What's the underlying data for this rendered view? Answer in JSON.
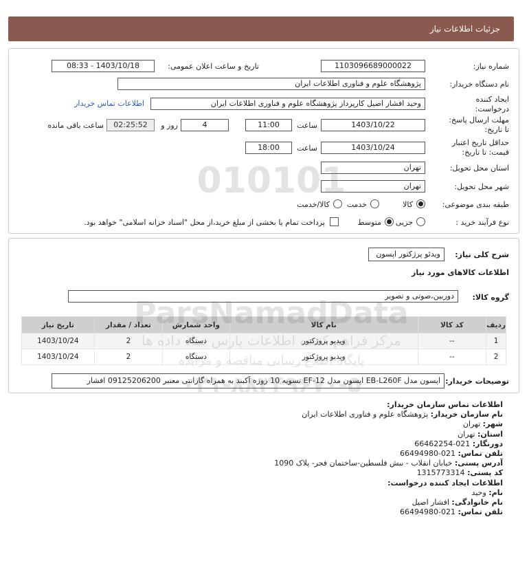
{
  "header": {
    "title": "جزئیات اطلاعات نیاز"
  },
  "form": {
    "need_number_label": "شماره نیاز:",
    "need_number": "1103096689000022",
    "announce_label": "تاریخ و ساعت اعلان عمومی:",
    "announce_value": "1403/10/18 - 08:33",
    "buyer_org_label": "نام دستگاه خریدار:",
    "buyer_org": "پژوهشگاه علوم و فناوری اطلاعات ایران",
    "creator_label_1": "ایجاد کننده",
    "creator_label_2": "درخواست:",
    "creator_value": "وحید افشار اصیل کارپرداز  پژوهشگاه علوم و فناوری اطلاعات ایران",
    "buyer_contact_link": "اطلاعات تماس خریدار",
    "reply_deadline_label_1": "مهلت ارسال پاسخ:",
    "reply_deadline_label_2": "تا تاریخ:",
    "reply_date": "1403/10/22",
    "time_label": "ساعت",
    "reply_time": "11:00",
    "days_value": "4",
    "days_label": "روز و",
    "remaining_time": "02:25:52",
    "remaining_label": "ساعت باقی مانده",
    "validity_label_1": "حداقل تاریخ اعتبار",
    "validity_label_2": "قیمت: تا تاریخ:",
    "validity_date": "1403/10/24",
    "validity_time": "18:00",
    "province_label": "استان محل تحویل:",
    "province": "تهران",
    "city_label": "شهر محل تحویل:",
    "city": "تهران",
    "category_label": "طبقه بندی موضوعی:",
    "category_options": [
      "کالا",
      "خدمت",
      "کالا/خدمت"
    ],
    "category_selected": "کالا",
    "process_label": "نوع فرآیند خرید :",
    "process_options": [
      "جزیی",
      "متوسط"
    ],
    "process_selected": "متوسط",
    "payment_note": "پرداخت تمام یا بخشی از مبلغ خرید،از محل \"اسناد خزانه اسلامی\" خواهد بود."
  },
  "summary": {
    "description_label": "شرح کلی نیاز:",
    "description_value": "ویدئو پرژکتور اپسون",
    "goods_info_title": "اطلاعات کالاهای مورد نیاز",
    "group_label": "گروه کالا:",
    "group_value": "دوربین،صوتی و تصویر",
    "table": {
      "headers": [
        "ردیف",
        "کد کالا",
        "نام کالا",
        "واحد شمارش",
        "تعداد / مقدار",
        "تاریخ نیاز"
      ],
      "rows": [
        [
          "1",
          "--",
          "ویدیو پروژکتور",
          "دستگاه",
          "2",
          "1403/10/24"
        ],
        [
          "2",
          "--",
          "ویدیو پروژکتور",
          "دستگاه",
          "2",
          "1403/10/24"
        ]
      ]
    },
    "buyer_notes_label": "توضیحات خریدار:",
    "buyer_notes_value": "اپسون مدل EB-L260F اپسون مدل EF-12 تسویه 10 روزه آکبند به همراه گارانتی معتبر 09125206200 افشار"
  },
  "contact": {
    "title": "اطلاعات تماس سازمان خریدار:",
    "buyer_name_label": "نام سازمان خریدار:",
    "buyer_name": "پژوهشگاه علوم و فناوری اطلاعات ایران",
    "city_label": "شهر:",
    "city": "تهران",
    "province_label": "استان:",
    "province": "تهران",
    "fax_label": "دورنگار:",
    "fax": "021-66462254",
    "phone_label": "تلفن تماس:",
    "phone": "021-66494980",
    "address_label": "آدرس پستی:",
    "address": "خیابان انقلاب - نبش فلسطین-ساختمان فجر- پلاک 1090",
    "postal_label": "کد پستی:",
    "postal": "1315773314",
    "creator_title": "اطلاعات ایجاد کننده درخواست:",
    "first_name_label": "نام:",
    "first_name": "وحید",
    "last_name_label": "نام خانوادگی:",
    "last_name": "افشار اصیل",
    "creator_phone_label": "تلفن تماس:",
    "creator_phone": "021-66494980"
  },
  "watermark": {
    "brand": "ParsNamadData",
    "tagline": "مرکز فراهم کننده اطلاعات پارس نماد داده ها",
    "subtitle": "پایگاه اطلاع رسانی مناقصه و مزایده",
    "phone": "۰۲۱-۸۸۳۴۹۶۷۰-۵",
    "number": "010101"
  },
  "colors": {
    "header_bg": "#8b5a4e",
    "link": "#2a5db0",
    "table_header": "#cfcfcf"
  }
}
